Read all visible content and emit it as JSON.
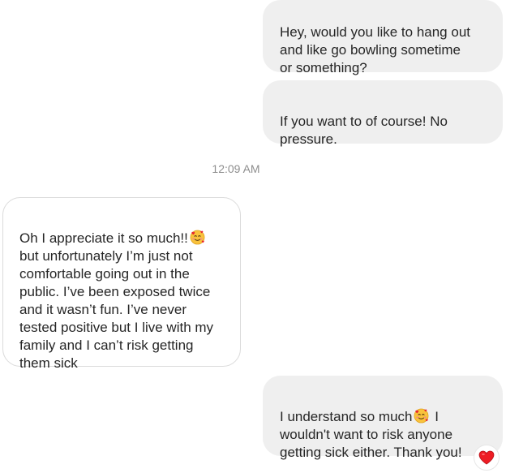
{
  "messages": [
    {
      "sender": "me",
      "text": "Hey, would you like to hang out\nand like go bowling sometime\nor something?"
    },
    {
      "sender": "me",
      "text": "If you want to of course! No\npressure."
    },
    {
      "sender": "them",
      "text_before_emoji": "Oh I appreciate it so much!!",
      "text_after_emoji": "\nbut unfortunately I’m just not\ncomfortable going out in the\npublic. I’ve been exposed twice\nand it wasn’t fun. I’ve never\ntested positive but I live with my\nfamily and I can’t risk getting\nthem sick"
    },
    {
      "sender": "me",
      "text_before_emoji": "I understand so much",
      "text_after_emoji": " I\nwouldn't want to risk anyone\ngetting sick either. Thank you!"
    }
  ],
  "timestamp": "12:09 AM",
  "icons": {
    "emoji": "smiling-face-with-hearts",
    "reaction": "red-heart"
  },
  "colors": {
    "sent_bubble": "#efefef",
    "received_border": "#dbdbdb",
    "heart": "#ed1c24"
  }
}
